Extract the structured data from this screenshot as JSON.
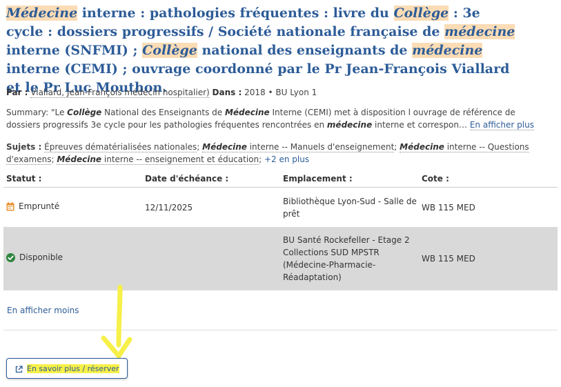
{
  "record": {
    "title": {
      "t1": "Médecine",
      "t2": " interne : pathologies fréquentes : livre du ",
      "t3": "Collège",
      "t4": " : 3e cycle : dossiers progressifs / Société nationale française de ",
      "t5": "médecine",
      "t6": " interne (SNFMI) ; ",
      "t7": "Collège",
      "t8": " national des enseignants de ",
      "t9": "médecine",
      "t10": " interne (CEMI) ; ouvrage coordonné par le Pr Jean-François Viallard et le Pr Luc Mouthon."
    },
    "meta": {
      "by_label": "Par :",
      "author": "Viallard, Jean-François médecin hospitalier)",
      "in_label": "Dans :",
      "year": "2018",
      "bullet": "•",
      "library": "BU Lyon 1"
    },
    "summary": {
      "s1": "Summary: \"Le ",
      "s2": "Collège",
      "s3": " National des Enseignants de ",
      "s4": "Médecine",
      "s5": " Interne (CEMI) met à disposition l ouvrage de référence de dossiers progressifs 3e cycle pour les pathologies fréquentes rencontrées en ",
      "s6": "médecine",
      "s7": " interne et correspon…",
      "more": "En afficher plus"
    },
    "subjects": {
      "label": "Sujets :",
      "p1": "Épreuves dématérialisées nationales",
      "sep1": "; ",
      "p2a": "Médecine",
      "p2b": " interne -- Manuels d'enseignement",
      "sep2": "; ",
      "p3a": "Médecine",
      "p3b": " interne -- Questions d'examens",
      "sep3": "; ",
      "p4a": "Médecine",
      "p4b": " interne -- enseignement et éducation",
      "sep4": ";",
      "more": "+2 en plus"
    }
  },
  "holdings": {
    "headers": {
      "status": "Statut :",
      "due": "Date d'échéance :",
      "location": "Emplacement :",
      "callno": "Cote :"
    },
    "rows": [
      {
        "status": "Emprunté",
        "due": "12/11/2025",
        "location": "Bibliothèque Lyon-Sud - Salle de prêt",
        "callno": "WB 115 MED"
      },
      {
        "status": "Disponible",
        "due": "",
        "location": "BU Santé Rockefeller - Etage 2 Collections SUD MPSTR (Médecine-Pharmacie-Réadaptation)",
        "callno": "WB 115 MED"
      }
    ],
    "show_less": "En afficher moins"
  },
  "action": {
    "label": "En savoir plus / réserver"
  },
  "icons": {
    "borrowed": "calendar-icon",
    "available": "check-circle-icon",
    "external": "external-link-icon"
  },
  "colors": {
    "link": "#2d5c98",
    "highlight": "#fbdcb5",
    "annotation": "#f6f048",
    "available_row": "#d9d9d9",
    "borrowed_icon": "#e8902e",
    "available_icon": "#2e8540"
  }
}
